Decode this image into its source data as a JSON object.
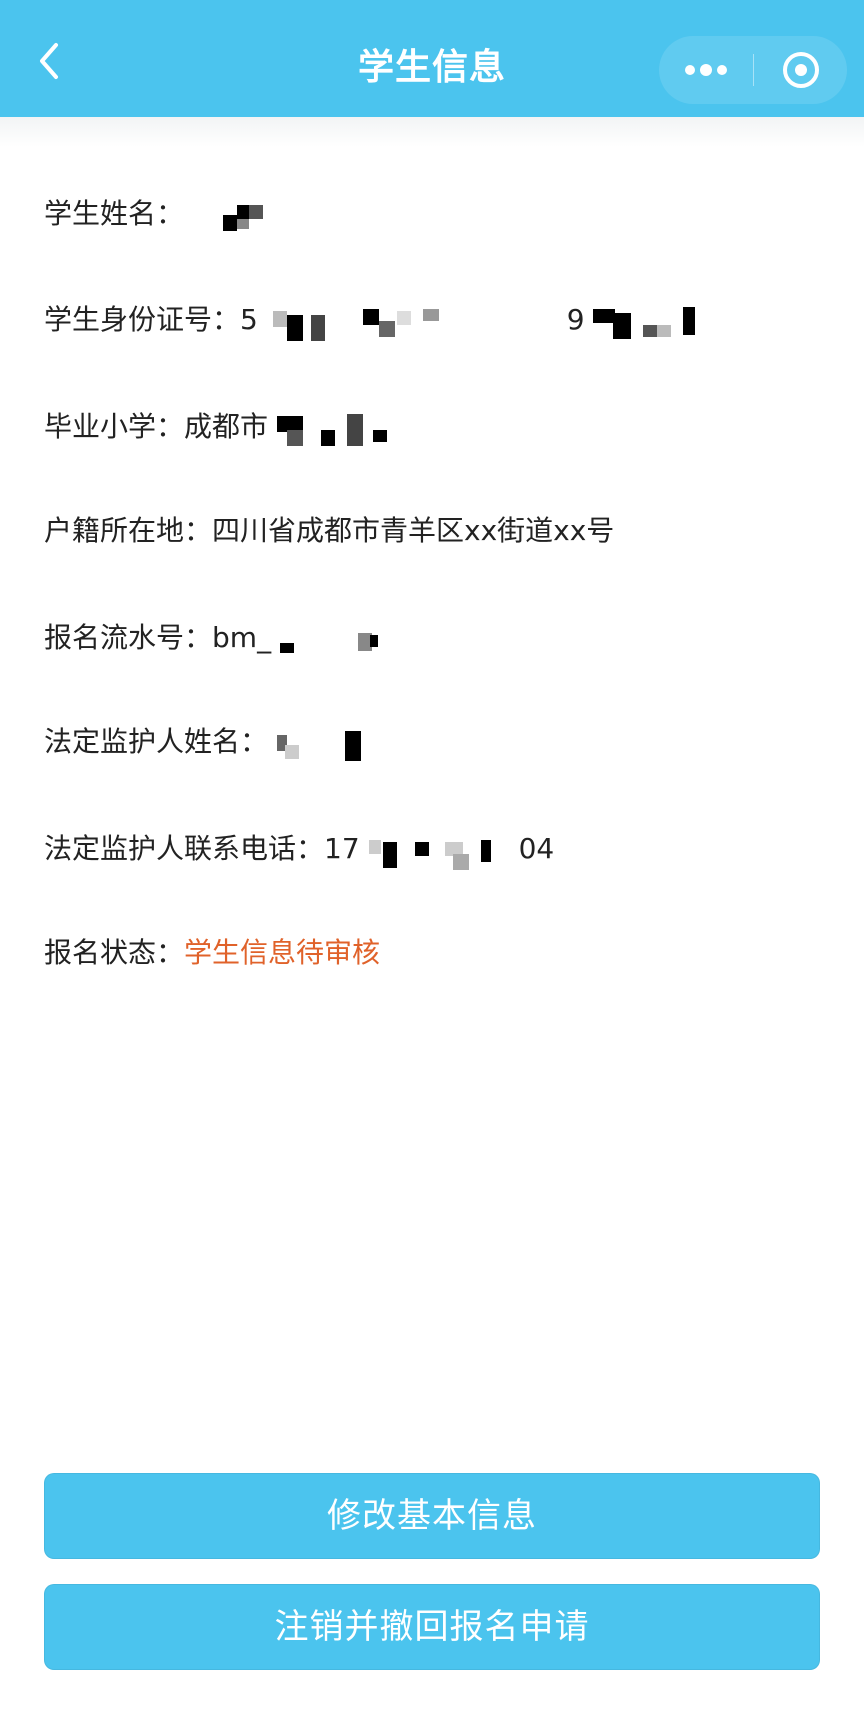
{
  "navbar": {
    "title": "学生信息",
    "back_icon": "chevron-left-icon",
    "more_icon": "more-dots-icon",
    "close_icon": "target-circle-icon",
    "background": "#4bc4ee"
  },
  "info": [
    {
      "label": "学生姓名：",
      "value": ""
    },
    {
      "label": "学生身份证号：",
      "value": "5",
      "value_mid": "9",
      "value_tail": ""
    },
    {
      "label": "毕业小学：",
      "value": "成都市"
    },
    {
      "label": "户籍所在地：",
      "value": "四川省成都市青羊区xx街道xx号"
    },
    {
      "label": "报名流水号：",
      "value": "bm_"
    },
    {
      "label": "法定监护人姓名：",
      "value": ""
    },
    {
      "label": "法定监护人联系电话：",
      "value": "17",
      "value_tail": "04"
    },
    {
      "label": "报名状态：",
      "value": "学生信息待审核",
      "value_color": "#e0622a"
    }
  ],
  "buttons": {
    "edit_label": "修改基本信息",
    "cancel_label": "注销并撤回报名申请"
  }
}
